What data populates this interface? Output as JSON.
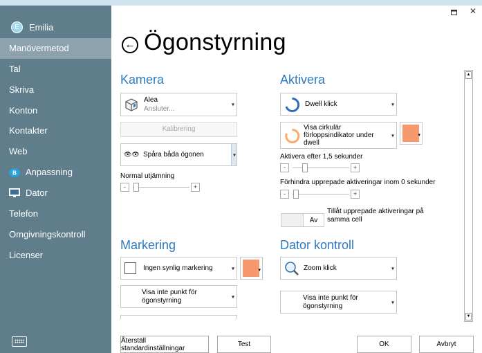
{
  "window": {
    "maximize_icon": "maximize-icon",
    "close_label": "✕"
  },
  "user": {
    "initial": "E",
    "name": "Emilia"
  },
  "sidebar": {
    "items": [
      {
        "label": "Manövermetod",
        "active": true
      },
      {
        "label": "Tal"
      },
      {
        "label": "Skriva"
      },
      {
        "label": "Konton"
      },
      {
        "label": "Kontakter"
      },
      {
        "label": "Web"
      },
      {
        "label": "Anpassning",
        "icon": "anpassning-icon"
      },
      {
        "label": "Dator",
        "icon": "monitor-icon"
      },
      {
        "label": "Telefon"
      },
      {
        "label": "Omgivningskontroll"
      },
      {
        "label": "Licenser"
      }
    ],
    "keyboard_icon": "keyboard-icon"
  },
  "page": {
    "title": "Ögonstyrning",
    "back_icon": "back-arrow-icon"
  },
  "kamera": {
    "heading": "Kamera",
    "device_name": "Alea",
    "device_status": "Ansluter...",
    "calibrate_label": "Kalibrering",
    "tracking_label": "Spåra båda ögonen",
    "smoothing_label": "Normal utjämning",
    "minus": "-",
    "plus": "+"
  },
  "markering": {
    "heading": "Markering",
    "marking_label": "Ingen synlig markering",
    "point_label": "Visa inte punkt för ögonstyrning"
  },
  "aktivera": {
    "heading": "Aktivera",
    "dwell_label": "Dwell klick",
    "progress_label": "Visa cirkulär förloppsindikator under dwell",
    "activate_after": "Aktivera efter 1,5 sekunder",
    "prevent_repeat": "Förhindra upprepade aktiveringar inom 0 sekunder",
    "toggle_value": "Av",
    "allow_repeat": "Tillåt upprepade aktiveringar på samma cell"
  },
  "dator_kontroll": {
    "heading": "Dator kontroll",
    "zoom_label": "Zoom klick",
    "point_label": "Visa inte punkt för ögonstyrning"
  },
  "colors": {
    "accent": "#2e7abf",
    "sidebar": "#607d8b",
    "swatch": "#f7996e",
    "progress": "#ffa76b"
  },
  "footer": {
    "reset_label": "Återställ standardinställningar",
    "test_label": "Test",
    "ok_label": "OK",
    "cancel_label": "Avbryt"
  }
}
